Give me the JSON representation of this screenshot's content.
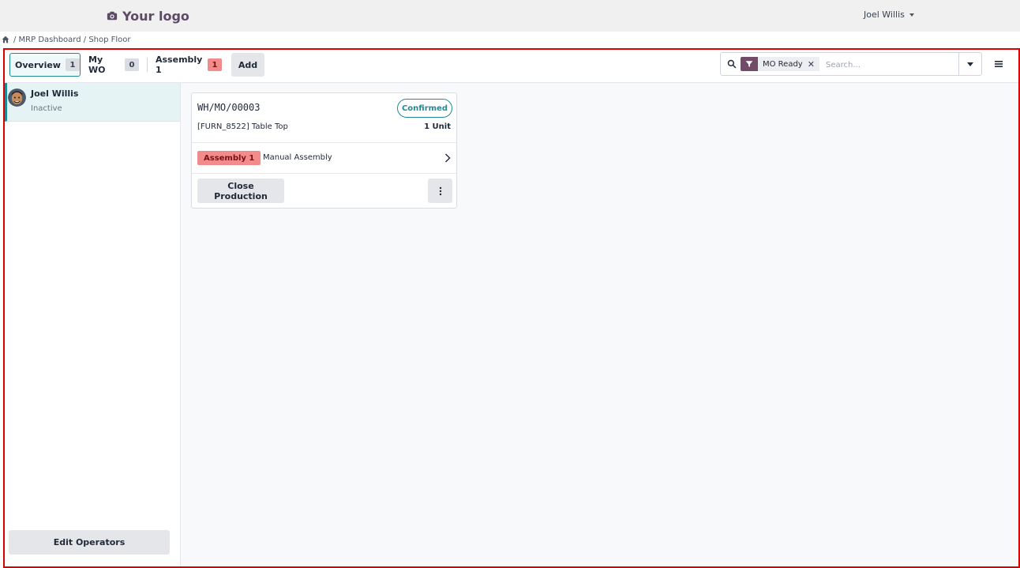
{
  "header": {
    "logo_text": "Your logo",
    "user_name": "Joel Willis"
  },
  "breadcrumb": {
    "text": "/ MRP Dashboard / Shop Floor"
  },
  "toolbar": {
    "tabs": [
      {
        "label": "Overview",
        "count": "1"
      },
      {
        "label": "My WO",
        "count": "0"
      },
      {
        "label": "Assembly 1",
        "count": "1"
      }
    ],
    "add_label": "Add"
  },
  "search": {
    "facet_label": "MO Ready",
    "placeholder": "Search..."
  },
  "sidebar": {
    "operator": {
      "name": "Joel Willis",
      "status": "Inactive"
    },
    "edit_operators_label": "Edit Operators"
  },
  "card": {
    "mo_name": "WH/MO/00003",
    "status": "Confirmed",
    "product": "[FURN_8522] Table Top",
    "quantity": "1 Unit",
    "workcenter": "Assembly 1",
    "workorder": "Manual Assembly",
    "close_label": "Close Production"
  },
  "colors": {
    "accent": "#1f8a96",
    "brand": "#714b67",
    "badge_red": "#f28b8b",
    "frame_border": "#dc0000"
  }
}
